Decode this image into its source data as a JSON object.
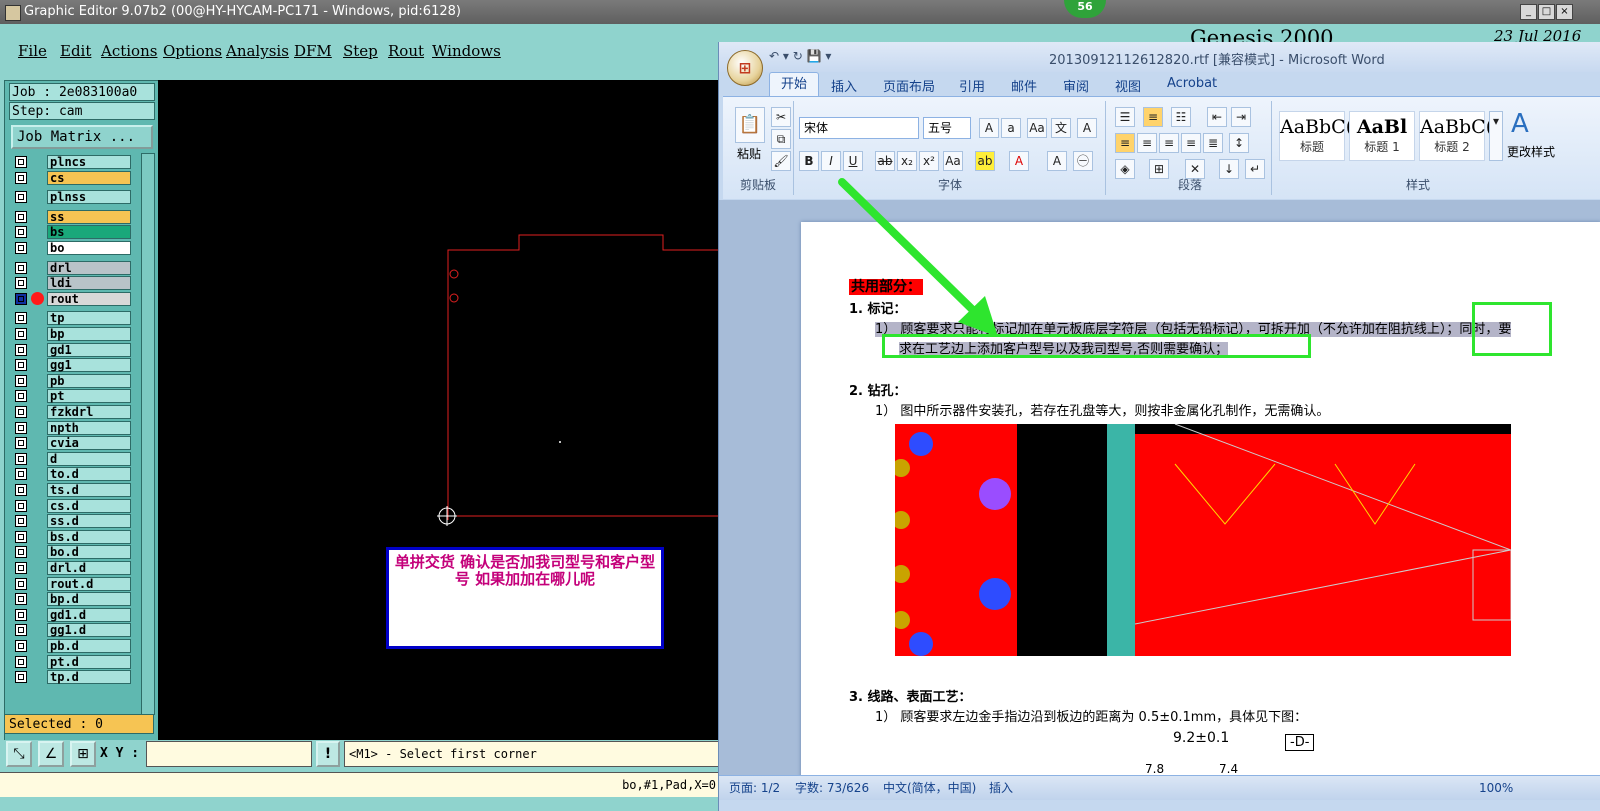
{
  "genesis": {
    "title": "Graphic Editor 9.07b2 (00@HY-HYCAM-PC171 - Windows, pid:6128)",
    "menu": [
      "File",
      "Edit",
      "Actions",
      "Options",
      "Analysis",
      "DFM",
      "Step",
      "Rout",
      "Windows"
    ],
    "brand": "Genesis 2000",
    "date": "23 Jul 2016",
    "job_label": "Job : 2e083100a0",
    "step_label": "Step: cam",
    "job_matrix_button": "Job Matrix ...",
    "layers": [
      {
        "name": "plncs",
        "color": "#a8e2dc"
      },
      {
        "name": "cs",
        "color": "#f6c453"
      },
      {
        "name": "plnss",
        "color": "#a8e2dc"
      },
      {
        "name": "ss",
        "color": "#f6c453"
      },
      {
        "name": "bs",
        "color": "#1aa87a"
      },
      {
        "name": "bo",
        "color": "#ffffff"
      },
      {
        "name": "drl",
        "color": "#b9c3c8"
      },
      {
        "name": "ldi",
        "color": "#b9c3c8"
      },
      {
        "name": "rout",
        "color": "#d8d8d8"
      },
      {
        "name": "tp",
        "color": "#a8e2dc"
      },
      {
        "name": "bp",
        "color": "#a8e2dc"
      },
      {
        "name": "gd1",
        "color": "#a8e2dc"
      },
      {
        "name": "gg1",
        "color": "#a8e2dc"
      },
      {
        "name": "pb",
        "color": "#a8e2dc"
      },
      {
        "name": "pt",
        "color": "#a8e2dc"
      },
      {
        "name": "fzkdrl",
        "color": "#a8e2dc"
      },
      {
        "name": "npth",
        "color": "#a8e2dc"
      },
      {
        "name": "cvia",
        "color": "#a8e2dc"
      },
      {
        "name": "d",
        "color": "#a8e2dc"
      },
      {
        "name": "to.d",
        "color": "#a8e2dc"
      },
      {
        "name": "ts.d",
        "color": "#a8e2dc"
      },
      {
        "name": "cs.d",
        "color": "#a8e2dc"
      },
      {
        "name": "ss.d",
        "color": "#a8e2dc"
      },
      {
        "name": "bs.d",
        "color": "#a8e2dc"
      },
      {
        "name": "bo.d",
        "color": "#a8e2dc"
      },
      {
        "name": "drl.d",
        "color": "#a8e2dc"
      },
      {
        "name": "rout.d",
        "color": "#a8e2dc"
      },
      {
        "name": "bp.d",
        "color": "#a8e2dc"
      },
      {
        "name": "gd1.d",
        "color": "#a8e2dc"
      },
      {
        "name": "gg1.d",
        "color": "#a8e2dc"
      },
      {
        "name": "pb.d",
        "color": "#a8e2dc"
      },
      {
        "name": "pt.d",
        "color": "#a8e2dc"
      },
      {
        "name": "tp.d",
        "color": "#a8e2dc"
      }
    ],
    "selected_label": "Selected : 0",
    "note_text": "单拼交货  确认是否加我司型号和客户型号  如果加加在哪儿呢",
    "xy_label": "X Y :",
    "prompt_text": "<M1> - Select first corner",
    "status_text": "bo,#1,Pad,X=0",
    "badge": "56"
  },
  "word": {
    "title": "20130912112612820.rtf [兼容模式] - Microsoft Word",
    "tabs": [
      "开始",
      "插入",
      "页面布局",
      "引用",
      "邮件",
      "审阅",
      "视图",
      "Acrobat"
    ],
    "clipboard": {
      "paste": "粘贴",
      "label": "剪贴板"
    },
    "font": {
      "name": "宋体",
      "size": "五号",
      "label": "字体"
    },
    "paragraph_label": "段落",
    "styles": {
      "label": "样式",
      "change": "更改样式",
      "tiles": [
        {
          "preview": "AaBbC(",
          "caption": "标题"
        },
        {
          "preview": "AaBl",
          "caption": "标题 1"
        },
        {
          "preview": "AaBbC(",
          "caption": "标题 2"
        }
      ]
    },
    "doc": {
      "heading": "共用部分：",
      "s1_title": "1.   标记：",
      "s1_item": "1）  顾客要求只能将标记加在单元板底层字符层（包括无铅标记），可拆开加（不允许加在阻抗线上）；同时，要",
      "s1_item2": "求在工艺边上添加客户型号以及我司型号,否则需要确认；",
      "s2_title": "2.   钻孔：",
      "s2_item": "1）  图中所示器件安装孔，若存在孔盘等大，则按非金属化孔制作，无需确认。",
      "s3_title": "3.   线路、表面工艺：",
      "s3_item": "1）  顾客要求左边金手指边沿到板边的距离为 0.5±0.1mm，具体见下图：",
      "dim_label": "9.2±0.1",
      "ref_label": "-D-",
      "small_1": "7.8",
      "small_2": "7.4"
    },
    "status": {
      "page": "页面: 1/2",
      "words": "字数: 73/626",
      "lang": "中文(简体，中国)",
      "mode": "插入",
      "zoom": "100%"
    }
  }
}
